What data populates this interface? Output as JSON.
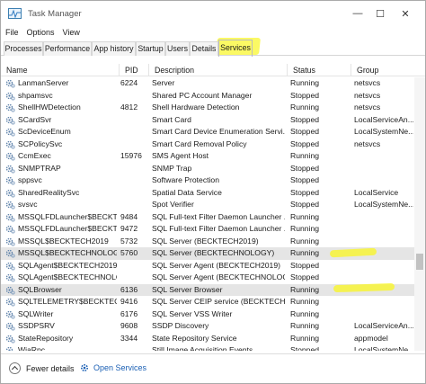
{
  "window": {
    "title": "Task Manager",
    "controls": {
      "minimize": "—",
      "maximize": "☐",
      "close": "✕"
    }
  },
  "menu": [
    "File",
    "Options",
    "View"
  ],
  "tabs": [
    {
      "label": "Processes",
      "active": false
    },
    {
      "label": "Performance",
      "active": false
    },
    {
      "label": "App history",
      "active": false
    },
    {
      "label": "Startup",
      "active": false
    },
    {
      "label": "Users",
      "active": false
    },
    {
      "label": "Details",
      "active": false
    },
    {
      "label": "Services",
      "active": true
    }
  ],
  "table": {
    "headers": [
      "Name",
      "PID",
      "Description",
      "Status",
      "Group"
    ],
    "sort_indicator": "^",
    "rows": [
      {
        "name": "LanmanServer",
        "pid": "6224",
        "description": "Server",
        "status": "Running",
        "group": "netsvcs"
      },
      {
        "name": "shpamsvc",
        "pid": "",
        "description": "Shared PC Account Manager",
        "status": "Stopped",
        "group": "netsvcs"
      },
      {
        "name": "ShellHWDetection",
        "pid": "4812",
        "description": "Shell Hardware Detection",
        "status": "Running",
        "group": "netsvcs"
      },
      {
        "name": "SCardSvr",
        "pid": "",
        "description": "Smart Card",
        "status": "Stopped",
        "group": "LocalServiceAn..."
      },
      {
        "name": "ScDeviceEnum",
        "pid": "",
        "description": "Smart Card Device Enumeration Servi...",
        "status": "Stopped",
        "group": "LocalSystemNe..."
      },
      {
        "name": "SCPolicySvc",
        "pid": "",
        "description": "Smart Card Removal Policy",
        "status": "Stopped",
        "group": "netsvcs"
      },
      {
        "name": "CcmExec",
        "pid": "15976",
        "description": "SMS Agent Host",
        "status": "Running",
        "group": ""
      },
      {
        "name": "SNMPTRAP",
        "pid": "",
        "description": "SNMP Trap",
        "status": "Stopped",
        "group": ""
      },
      {
        "name": "sppsvc",
        "pid": "",
        "description": "Software Protection",
        "status": "Stopped",
        "group": ""
      },
      {
        "name": "SharedRealitySvc",
        "pid": "",
        "description": "Spatial Data Service",
        "status": "Stopped",
        "group": "LocalService"
      },
      {
        "name": "svsvc",
        "pid": "",
        "description": "Spot Verifier",
        "status": "Stopped",
        "group": "LocalSystemNe..."
      },
      {
        "name": "MSSQLFDLauncher$BECKTE...",
        "pid": "9484",
        "description": "SQL Full-text Filter Daemon Launcher ...",
        "status": "Running",
        "group": ""
      },
      {
        "name": "MSSQLFDLauncher$BECKTE...",
        "pid": "9472",
        "description": "SQL Full-text Filter Daemon Launcher ...",
        "status": "Running",
        "group": ""
      },
      {
        "name": "MSSQL$BECKTECH2019",
        "pid": "5732",
        "description": "SQL Server (BECKTECH2019)",
        "status": "Running",
        "group": ""
      },
      {
        "name": "MSSQL$BECKTECHNOLOGY",
        "pid": "5760",
        "description": "SQL Server (BECKTECHNOLOGY)",
        "status": "Running",
        "group": "",
        "selected": true
      },
      {
        "name": "SQLAgent$BECKTECH2019",
        "pid": "",
        "description": "SQL Server Agent (BECKTECH2019)",
        "status": "Stopped",
        "group": ""
      },
      {
        "name": "SQLAgent$BECKTECHNOLO...",
        "pid": "",
        "description": "SQL Server Agent (BECKTECHNOLOGY)",
        "status": "Stopped",
        "group": ""
      },
      {
        "name": "SQLBrowser",
        "pid": "6136",
        "description": "SQL Server Browser",
        "status": "Running",
        "group": "",
        "selected": true
      },
      {
        "name": "SQLTELEMETRY$BECKTECH...",
        "pid": "9416",
        "description": "SQL Server CEIP service (BECKTECH...",
        "status": "Running",
        "group": ""
      },
      {
        "name": "SQLWriter",
        "pid": "6176",
        "description": "SQL Server VSS Writer",
        "status": "Running",
        "group": ""
      },
      {
        "name": "SSDPSRV",
        "pid": "9608",
        "description": "SSDP Discovery",
        "status": "Running",
        "group": "LocalServiceAn..."
      },
      {
        "name": "StateRepository",
        "pid": "3344",
        "description": "State Repository Service",
        "status": "Running",
        "group": "appmodel"
      },
      {
        "name": "WiaRpc",
        "pid": "",
        "description": "Still Image Acquisition Events",
        "status": "Stopped",
        "group": "LocalSystemNe..."
      }
    ]
  },
  "footer": {
    "fewer_details": "Fewer details",
    "open_services": "Open Services"
  },
  "colors": {
    "highlight": "#faf628",
    "link": "#1a5fb4",
    "selected_row": "#e5e5e5"
  }
}
